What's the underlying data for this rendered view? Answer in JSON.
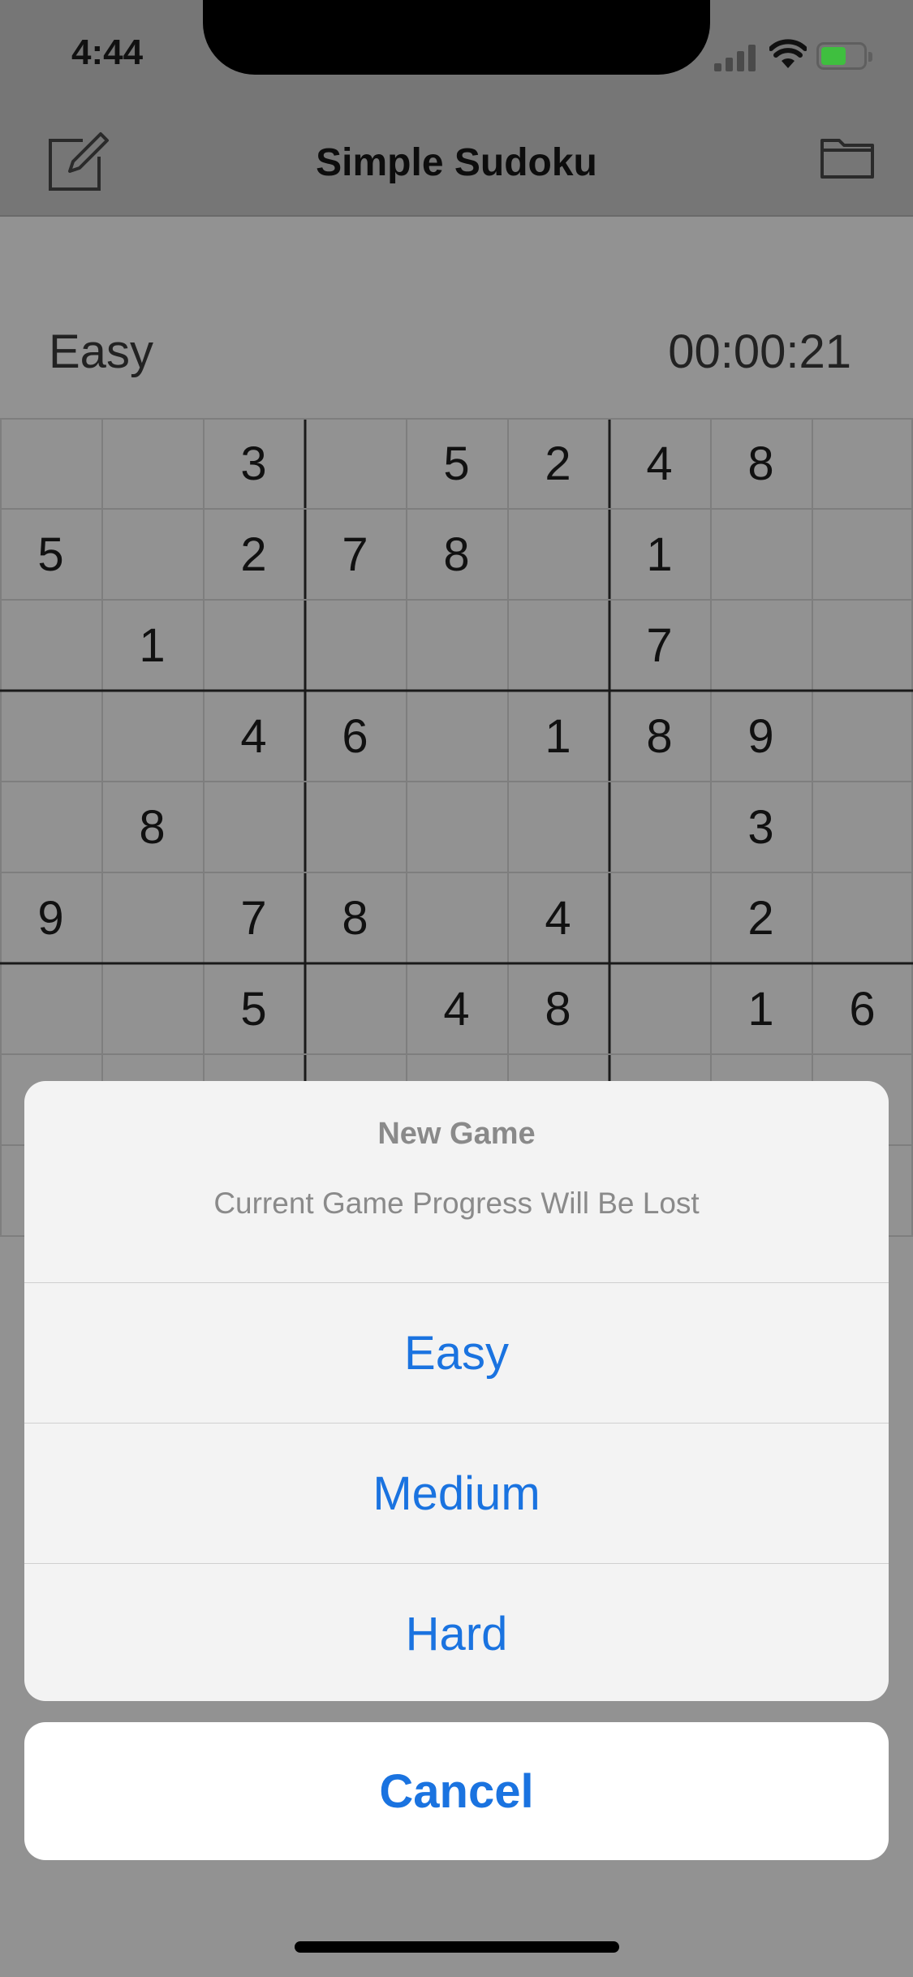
{
  "status_bar": {
    "time": "4:44",
    "icons": [
      "signal-icon",
      "wifi-icon",
      "battery-icon"
    ],
    "battery_color": "#3fbf3f"
  },
  "nav": {
    "title": "Simple Sudoku",
    "left_icon": "compose-icon",
    "right_icon": "folder-icon"
  },
  "game": {
    "difficulty": "Easy",
    "timer": "00:00:21"
  },
  "grid": [
    [
      "",
      "",
      "3",
      "",
      "5",
      "2",
      "4",
      "8",
      ""
    ],
    [
      "5",
      "",
      "2",
      "7",
      "8",
      "",
      "1",
      "",
      ""
    ],
    [
      "",
      "1",
      "",
      "",
      "",
      "",
      "7",
      "",
      ""
    ],
    [
      "",
      "",
      "4",
      "6",
      "",
      "1",
      "8",
      "9",
      ""
    ],
    [
      "",
      "8",
      "",
      "",
      "",
      "",
      "",
      "3",
      ""
    ],
    [
      "9",
      "",
      "7",
      "8",
      "",
      "4",
      "",
      "2",
      ""
    ],
    [
      "",
      "",
      "5",
      "",
      "4",
      "8",
      "",
      "1",
      "6"
    ]
  ],
  "action_sheet": {
    "title": "New Game",
    "message": "Current Game Progress Will Be Lost",
    "options": [
      "Easy",
      "Medium",
      "Hard"
    ],
    "cancel": "Cancel"
  },
  "colors": {
    "accent": "#1a73e0",
    "overlay": "#929292",
    "sheet_bg": "#f3f3f3"
  }
}
